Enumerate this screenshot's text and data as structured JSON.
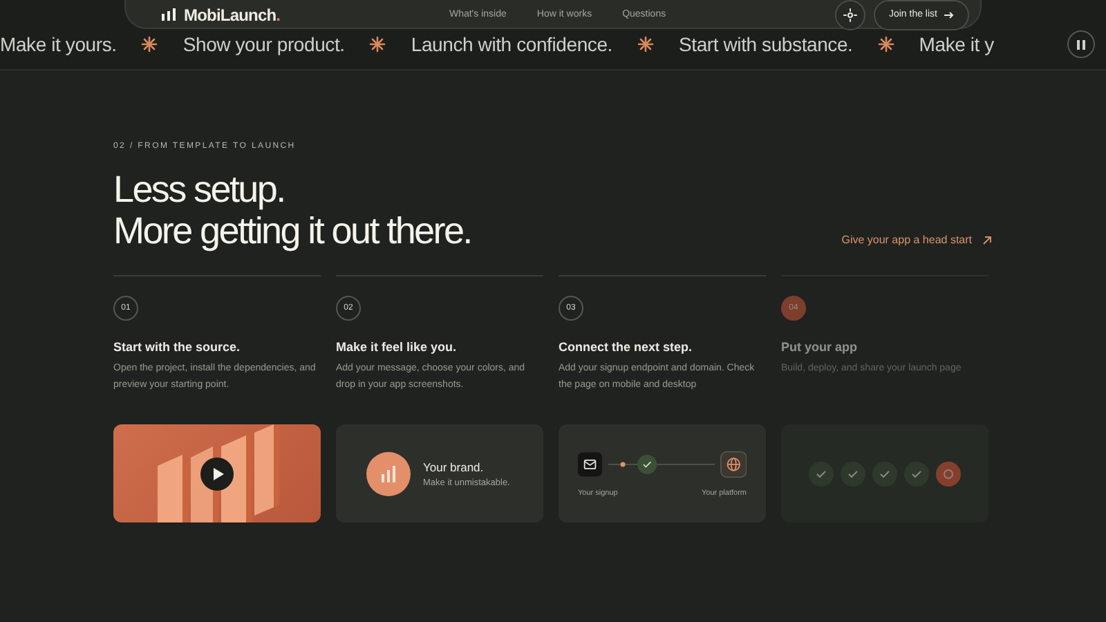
{
  "nav": {
    "logo": "MobiLaunch.",
    "links": [
      "What's inside",
      "How it works",
      "Questions"
    ],
    "cta": "Join the list"
  },
  "marquee": {
    "items": [
      "Make it yours.",
      "Show your product.",
      "Launch with confidence.",
      "Start with substance.",
      "Make it y"
    ]
  },
  "section": {
    "eyebrow": "02 / FROM TEMPLATE TO LAUNCH",
    "heading": [
      "Less setup.",
      "More getting it out there."
    ],
    "link": "Give your app a head start"
  },
  "steps": [
    {
      "number": "01",
      "selected": false,
      "title": "Start with the source.",
      "text": "Open the project, install the dependencies, and preview your starting point.",
      "card": {
        "kind": "video"
      }
    },
    {
      "number": "02",
      "selected": false,
      "title": "Make it feel like you.",
      "text": "Add your message, choose your colors, and drop in your app screenshots.",
      "card": {
        "kind": "brand",
        "title": "Your brand.",
        "subtitle": "Make it unmistakable."
      }
    },
    {
      "number": "03",
      "selected": false,
      "title": "Connect the next step.",
      "text": "Add your signup endpoint and domain. Check the page on mobile and desktop",
      "card": {
        "kind": "flow",
        "from": "Your signup",
        "to": "Your platform"
      }
    },
    {
      "number": "04",
      "selected": true,
      "title": "Put your app",
      "text": "Build, deploy, and share your launch page",
      "card": {
        "kind": "progress",
        "checks": [
          {
            "done": true
          },
          {
            "done": true
          },
          {
            "done": true
          },
          {
            "done": true
          },
          {
            "done": false
          }
        ]
      }
    }
  ]
}
